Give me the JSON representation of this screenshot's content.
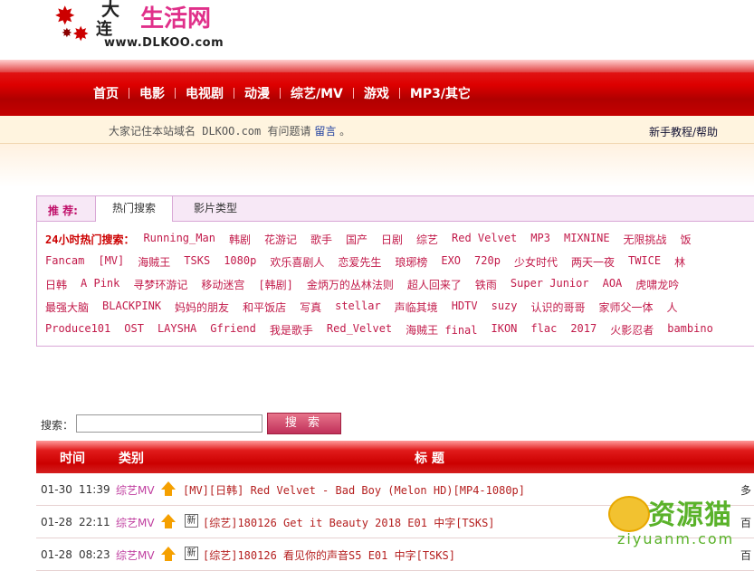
{
  "site": {
    "logo_char1": "大",
    "logo_char2": "连",
    "logo_name": "生活网",
    "logo_url": "www.DLKOO.com"
  },
  "nav": [
    "首页",
    "电影",
    "电视剧",
    "动漫",
    "综艺/MV",
    "游戏",
    "MP3/其它"
  ],
  "notice": {
    "text": "大家记住本站域名 DLKOO.com 有问题请",
    "link": "留言",
    "tail": "。",
    "help": "新手教程/帮助"
  },
  "hot": {
    "label": "推 荐:",
    "tabs": [
      "热门搜索",
      "影片类型"
    ],
    "row_label": "24小时热门搜索：",
    "rows": [
      [
        "Running_Man",
        "韩剧",
        "花游记",
        "歌手",
        "国产",
        "日剧",
        "综艺",
        "Red Velvet",
        "MP3",
        "MIXNINE",
        "无限挑战",
        "饭"
      ],
      [
        "Fancam",
        "[MV]",
        "海贼王",
        "TSKS",
        "1080p",
        "欢乐喜剧人",
        "恋爱先生",
        "琅琊榜",
        "EXO",
        "720p",
        "少女时代",
        "两天一夜",
        "TWICE",
        "林"
      ],
      [
        "日韩",
        "A Pink",
        "寻梦环游记",
        "移动迷宫",
        "[韩剧]",
        "金炳万的丛林法则",
        "超人回来了",
        "铁雨",
        "Super Junior",
        "AOA",
        "虎啸龙吟"
      ],
      [
        "最强大脑",
        "BLACKPINK",
        "妈妈的朋友",
        "和平饭店",
        "写真",
        "stellar",
        "声临其境",
        "HDTV",
        "suzy",
        "认识的哥哥",
        "家师父一体",
        "人"
      ],
      [
        "Produce101",
        "OST",
        "LAYSHA",
        "Gfriend",
        "我是歌手",
        "Red_Velvet",
        "海贼王 final",
        "IKON",
        "flac",
        "2017",
        "火影忍者",
        "bambino"
      ]
    ]
  },
  "search": {
    "label": "搜索：",
    "placeholder": "",
    "button": "搜 索"
  },
  "table": {
    "headers": [
      "时间",
      "类别",
      "标 题"
    ],
    "rows": [
      {
        "date": "01-30",
        "time": "11:39",
        "cat": "综艺MV",
        "new": "",
        "title": "[MV][日韩] Red Velvet - Bad Boy (Melon HD)[MP4-1080p]",
        "more": "多"
      },
      {
        "date": "01-28",
        "time": "22:11",
        "cat": "综艺MV",
        "new": "新",
        "title": "[综艺]180126 Get it Beauty 2018 E01 中字[TSKS]",
        "more": "百"
      },
      {
        "date": "01-28",
        "time": "08:23",
        "cat": "综艺MV",
        "new": "新",
        "title": "[综艺]180126 看见你的声音S5 E01 中字[TSKS]",
        "more": "百"
      }
    ]
  },
  "watermark": {
    "text": "资源猫",
    "url": "ziyuanm.com"
  }
}
